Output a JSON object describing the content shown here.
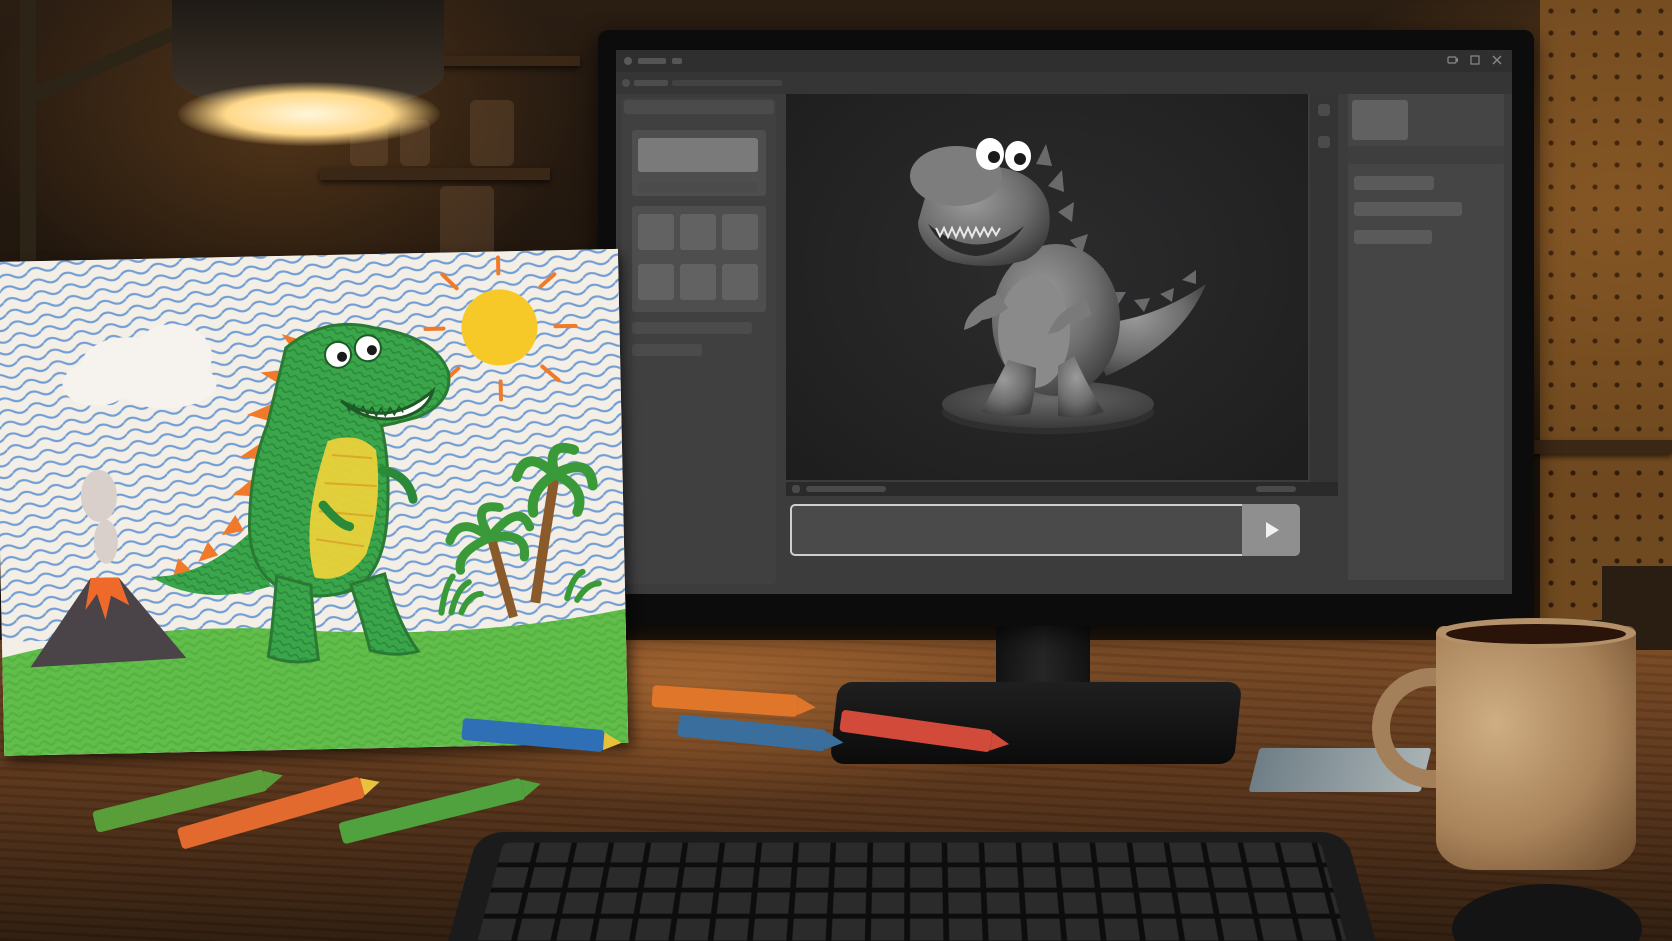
{
  "scene": {
    "description_tags": [
      "workshop-desk",
      "monitor",
      "child-crayon-drawing",
      "crayons",
      "keyboard",
      "coffee-mug",
      "desk-lamp"
    ]
  },
  "app": {
    "window_controls": [
      "camera-icon",
      "restore-icon",
      "close-icon"
    ],
    "send_button_icon": "play-icon",
    "colors": {
      "window_bg": "#3c3c3d",
      "viewport_bg": "#222223",
      "prompt_border": "#cfcfcf",
      "send_button": "#8f8f90"
    }
  },
  "drawing": {
    "colors": {
      "dino_body": "#3aa54a",
      "dino_belly": "#f0d23a",
      "dino_spikes": "#f07a2a",
      "sun": "#f6c928",
      "sky_scribble": "#5a8fd1",
      "grass": "#55b845",
      "volcano": "#4a4448",
      "lava": "#ef6a2a"
    }
  },
  "crayons": [
    {
      "color": "#e0762a"
    },
    {
      "color": "#2f6fb6"
    },
    {
      "color": "#d24a3a"
    },
    {
      "color": "#3a6e9c"
    },
    {
      "color": "#5a9e3a"
    },
    {
      "color": "#e26a2e"
    },
    {
      "color": "#4fa23d"
    }
  ]
}
